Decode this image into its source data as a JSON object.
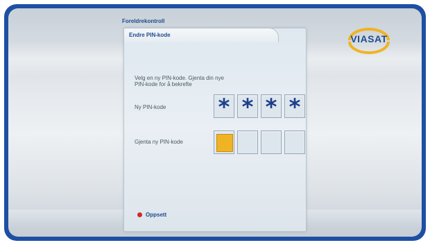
{
  "header": {
    "title": "Foreldrekontroll",
    "tab_label": "Endre PIN-kode",
    "logo_text": "VIASAT"
  },
  "instructions": {
    "line1": "Velg en ny PIN-kode. Gjenta din nye",
    "line2": "PIN-kode for å bekrefte"
  },
  "new_pin": {
    "label": "Ny PIN-kode",
    "digits": [
      "*",
      "*",
      "*",
      "*"
    ]
  },
  "repeat_pin": {
    "label": "Gjenta ny PIN-kode",
    "entered_count": 0,
    "active_index": 0
  },
  "footer": {
    "setup_label": "Oppsett"
  },
  "colors": {
    "frame": "#1d4fa3",
    "accent": "#f0b323",
    "text_blue": "#1f4d8c",
    "status_red": "#d22828"
  }
}
